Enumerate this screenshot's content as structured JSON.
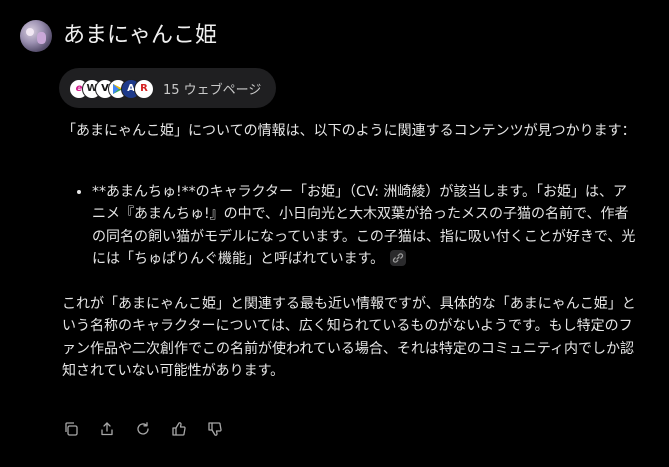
{
  "header": {
    "title": "あまにゃんこ姫",
    "avatar_icon": "user-avatar"
  },
  "sources": {
    "label": "15 ウェブページ",
    "favicons": [
      {
        "icon": "e-site-favicon",
        "glyph": "e"
      },
      {
        "icon": "w-site-favicon",
        "glyph": "W"
      },
      {
        "icon": "v-site-favicon",
        "glyph": "V"
      },
      {
        "icon": "play-store-favicon",
        "glyph": ""
      },
      {
        "icon": "anime-site-favicon",
        "glyph": "A"
      },
      {
        "icon": "r-site-favicon",
        "glyph": "R"
      }
    ]
  },
  "answer": {
    "intro": "「あまにゃんこ姫」についての情報は、以下のように関連するコンテンツが見つかります：",
    "bullets": [
      "**あまんちゅ!**のキャラクター「お姫」（CV: 洲崎綾）が該当します。「お姫」は、アニメ『あまんちゅ!』の中で、小日向光と大木双葉が拾ったメスの子猫の名前で、作者の同名の飼い猫がモデルになっています。この子猫は、指に吸い付くことが好きで、光には「ちゅぱりんぐ機能」と呼ばれています。"
    ],
    "conclusion": "これが「あまにゃんこ姫」と関連する最も近い情報ですが、具体的な「あまにゃんこ姫」という名称のキャラクターについては、広く知られているものがないようです。もし特定のファン作品や二次創作でこの名前が使われている場合、それは特定のコミュニティ内でしか認知されていない可能性があります。"
  },
  "actions": [
    {
      "name": "copy-icon"
    },
    {
      "name": "share-icon"
    },
    {
      "name": "regenerate-icon"
    },
    {
      "name": "thumbs-up-icon"
    },
    {
      "name": "thumbs-down-icon"
    }
  ],
  "colors": {
    "background": "#000000",
    "text": "#e6e6e6",
    "pill": "#1f1f21"
  }
}
